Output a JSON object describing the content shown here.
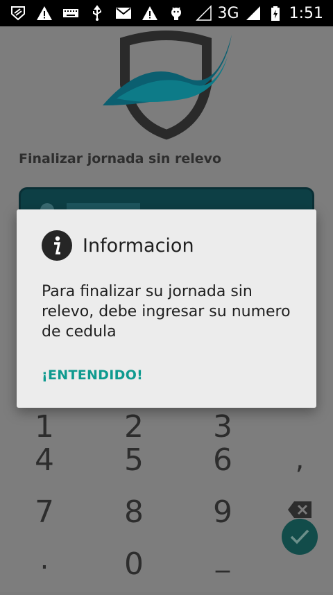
{
  "status_bar": {
    "network": "3G",
    "time": "1:51",
    "icons_left": [
      "shield-icon",
      "warning-icon",
      "keyboard-icon",
      "usb-icon",
      "mail-icon",
      "warning-icon",
      "android-icon"
    ],
    "icons_right": [
      "signal-empty-icon",
      "signal-3g-icon",
      "battery-charging-icon"
    ]
  },
  "app": {
    "title": "Finalizar jornada sin relevo",
    "brand_colors": {
      "shield": "#2a2a2a",
      "wing": "#0c6e82"
    }
  },
  "keypad": {
    "keys": [
      "1",
      "2",
      "3",
      "4",
      "5",
      "6",
      ",",
      "7",
      "8",
      "9",
      "0",
      ".",
      "_"
    ],
    "delete_icon": "backspace-icon",
    "confirm_icon": "check-icon"
  },
  "dialog": {
    "icon": "info-icon",
    "title": "Informacion",
    "message": "Para finalizar su jornada sin relevo, debe ingresar su numero de cedula",
    "button": "¡ENTENDIDO!",
    "accent": "#0e9a8f"
  }
}
